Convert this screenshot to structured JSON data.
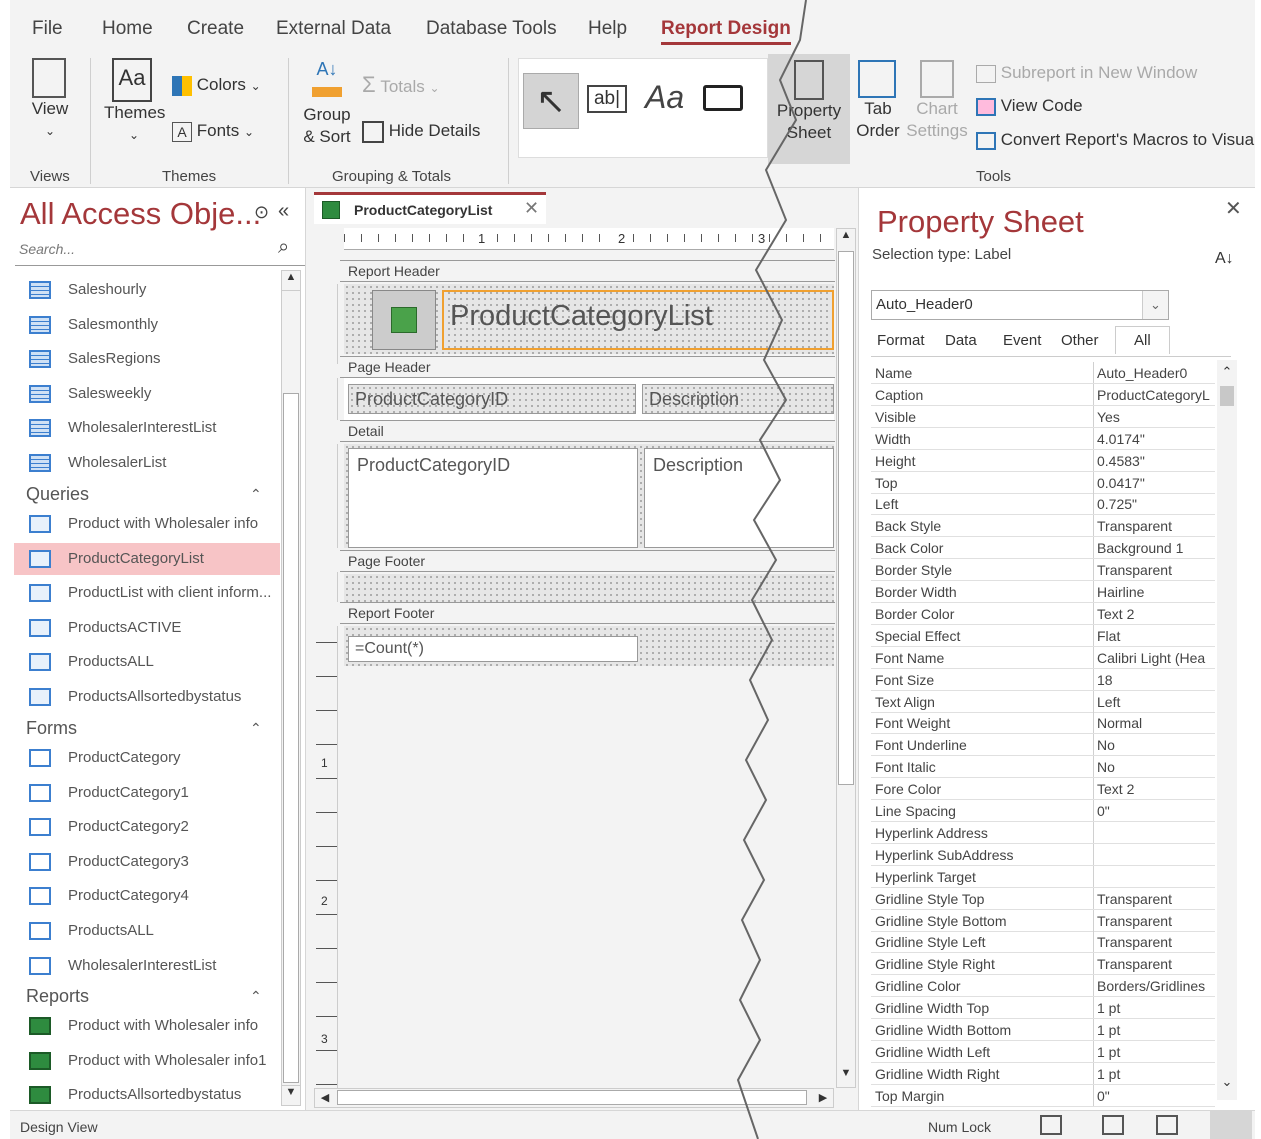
{
  "ribbon": {
    "tabs": [
      "File",
      "Home",
      "Create",
      "External Data",
      "Database Tools",
      "Help",
      "Report Design"
    ],
    "active_tab": "Report Design",
    "buttons": {
      "view": "View",
      "themes": "Themes",
      "colors": "Colors",
      "fonts": "Fonts",
      "group_sort_1": "Group",
      "group_sort_2": "& Sort",
      "totals": "Totals",
      "hide_details": "Hide Details",
      "text_ab": "ab|",
      "label_aa": "Aa",
      "property_sheet_1": "Property",
      "property_sheet_2": "Sheet",
      "tab_order_1": "Tab",
      "tab_order_2": "Order",
      "chart_settings_1": "Chart",
      "chart_settings_2": "Settings",
      "subreport": "Subreport in New Window",
      "view_code": "View Code",
      "convert_macros": "Convert Report's Macros to Visua"
    },
    "groups": [
      "Views",
      "Themes",
      "Grouping & Totals",
      "Tools"
    ]
  },
  "nav": {
    "title": "All Access Obje...",
    "search_placeholder": "Search...",
    "tables": [
      "Saleshourly",
      "Salesmonthly",
      "SalesRegions",
      "Salesweekly",
      "WholesalerInterestList",
      "WholesalerList"
    ],
    "queries_header": "Queries",
    "queries": [
      "Product with Wholesaler info",
      "ProductCategoryList",
      "ProductList with client inform...",
      "ProductsACTIVE",
      "ProductsALL",
      "ProductsAllsortedbystatus"
    ],
    "forms_header": "Forms",
    "forms": [
      "ProductCategory",
      "ProductCategory1",
      "ProductCategory2",
      "ProductCategory3",
      "ProductCategory4",
      "ProductsALL",
      "WholesalerInterestList"
    ],
    "reports_header": "Reports",
    "reports": [
      "Product with Wholesaler info",
      "Product with Wholesaler info1",
      "ProductsAllsortedbystatus"
    ]
  },
  "document": {
    "tab_title": "ProductCategoryList",
    "ruler_marks": [
      "1",
      "2",
      "3"
    ],
    "vruler_marks": [
      "1",
      "2",
      "3"
    ],
    "bands": {
      "report_header": "Report Header",
      "page_header": "Page Header",
      "detail": "Detail",
      "page_footer": "Page Footer",
      "report_footer": "Report Footer"
    },
    "title_label": "ProductCategoryList",
    "ph_id": "ProductCategoryID",
    "ph_desc": "Description",
    "detail_id": "ProductCategoryID",
    "detail_desc": "Description",
    "footer_count": "=Count(*)"
  },
  "property_sheet": {
    "title": "Property Sheet",
    "selection_type": "Selection type:  Label",
    "selected_object": "Auto_Header0",
    "tabs": [
      "Format",
      "Data",
      "Event",
      "Other",
      "All"
    ],
    "active_tab": "All",
    "rows": [
      [
        "Name",
        "Auto_Header0"
      ],
      [
        "Caption",
        "ProductCategoryL"
      ],
      [
        "Visible",
        "Yes"
      ],
      [
        "Width",
        "4.0174\""
      ],
      [
        "Height",
        "0.4583\""
      ],
      [
        "Top",
        "0.0417\""
      ],
      [
        "Left",
        "0.725\""
      ],
      [
        "Back Style",
        "Transparent"
      ],
      [
        "Back Color",
        "Background 1"
      ],
      [
        "Border Style",
        "Transparent"
      ],
      [
        "Border Width",
        "Hairline"
      ],
      [
        "Border Color",
        "Text 2"
      ],
      [
        "Special Effect",
        "Flat"
      ],
      [
        "Font Name",
        "Calibri Light (Hea"
      ],
      [
        "Font Size",
        "18"
      ],
      [
        "Text Align",
        "Left"
      ],
      [
        "Font Weight",
        "Normal"
      ],
      [
        "Font Underline",
        "No"
      ],
      [
        "Font Italic",
        "No"
      ],
      [
        "Fore Color",
        "Text 2"
      ],
      [
        "Line Spacing",
        "0\""
      ],
      [
        "Hyperlink Address",
        ""
      ],
      [
        "Hyperlink SubAddress",
        ""
      ],
      [
        "Hyperlink Target",
        ""
      ],
      [
        "Gridline Style Top",
        "Transparent"
      ],
      [
        "Gridline Style Bottom",
        "Transparent"
      ],
      [
        "Gridline Style Left",
        "Transparent"
      ],
      [
        "Gridline Style Right",
        "Transparent"
      ],
      [
        "Gridline Color",
        "Borders/Gridlines"
      ],
      [
        "Gridline Width Top",
        "1 pt"
      ],
      [
        "Gridline Width Bottom",
        "1 pt"
      ],
      [
        "Gridline Width Left",
        "1 pt"
      ],
      [
        "Gridline Width Right",
        "1 pt"
      ],
      [
        "Top Margin",
        "0\""
      ]
    ]
  },
  "status": {
    "left": "Design View",
    "num_lock": "Num Lock"
  },
  "colors": {
    "accent": "#a4373a",
    "selected_item": "#f7c4c6",
    "selection_outline": "#f0a030"
  }
}
